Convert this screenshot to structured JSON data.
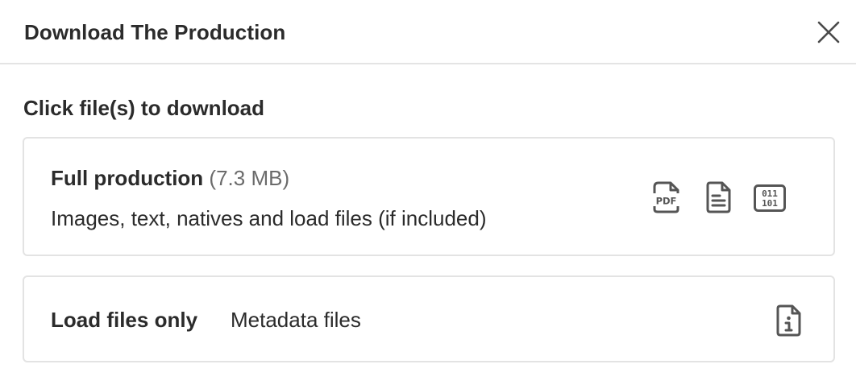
{
  "dialog": {
    "title": "Download The Production",
    "close_icon": "close-icon"
  },
  "section": {
    "heading": "Click file(s) to download"
  },
  "full_production": {
    "name": "Full production",
    "size": "(7.3 MB)",
    "description": "Images, text, natives and load files (if included)",
    "icons": {
      "pdf": "pdf-file-icon",
      "text": "text-file-icon",
      "binary": "binary-file-icon"
    },
    "icon_pdf_label": "PDF",
    "icon_binary_top": "011",
    "icon_binary_bottom": "101"
  },
  "load_files": {
    "name": "Load files only",
    "description": "Metadata files",
    "icon": "info-file-icon"
  },
  "colors": {
    "text": "#2b2b2b",
    "muted": "#6b6b6b",
    "border": "#e3e3e3",
    "icon": "#555555"
  }
}
